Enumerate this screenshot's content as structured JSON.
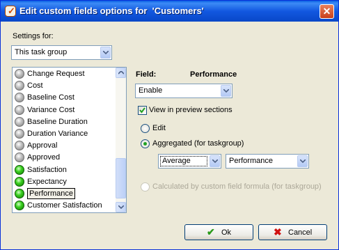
{
  "window": {
    "title": "Edit custom fields options for  'Customers'",
    "close_glyph": "✕"
  },
  "settings": {
    "label": "Settings for:",
    "selected": "This task group"
  },
  "fields_list": {
    "items": [
      {
        "label": "Change Request",
        "status": "gray"
      },
      {
        "label": "Cost",
        "status": "gray"
      },
      {
        "label": "Baseline Cost",
        "status": "gray"
      },
      {
        "label": "Variance Cost",
        "status": "gray"
      },
      {
        "label": "Baseline Duration",
        "status": "gray"
      },
      {
        "label": "Duration Variance",
        "status": "gray"
      },
      {
        "label": "Approval",
        "status": "gray"
      },
      {
        "label": "Approved",
        "status": "gray"
      },
      {
        "label": "Satisfaction",
        "status": "green"
      },
      {
        "label": "Expectancy",
        "status": "green"
      },
      {
        "label": "Performance",
        "status": "green",
        "selected": true
      },
      {
        "label": "Customer Satisfaction",
        "status": "green"
      }
    ]
  },
  "field_panel": {
    "field_label": "Field:",
    "field_name": "Performance",
    "enable_select": "Enable",
    "view_in_preview": {
      "label": "View in preview sections",
      "checked": true
    },
    "radio_edit": {
      "label": "Edit",
      "checked": false
    },
    "radio_aggregated": {
      "label": "Aggregated (for taskgroup)",
      "checked": true
    },
    "aggregate_function": "Average",
    "aggregate_field": "Performance",
    "radio_calculated": {
      "label": "Calculated by custom field formula (for taskgroup)",
      "checked": false,
      "disabled": true
    }
  },
  "buttons": {
    "ok_label": "Ok",
    "ok_icon": "✔",
    "cancel_label": "Cancel",
    "cancel_icon": "✖"
  },
  "colors": {
    "ok_icon": "#2a9a1a",
    "cancel_icon": "#d01010"
  }
}
